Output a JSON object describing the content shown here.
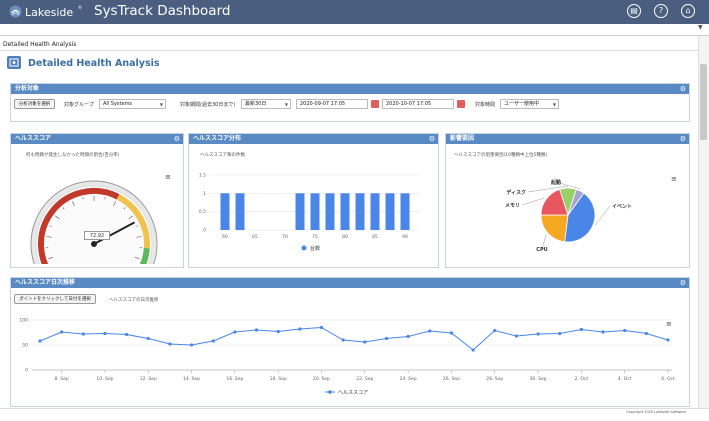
{
  "header": {
    "brand": "Lakeside",
    "brand_reg": "®",
    "app_title": "SysTrack Dashboard",
    "icons": [
      "clipboard-icon",
      "help-icon",
      "home-icon"
    ]
  },
  "breadcrumb": "Detailed Health Analysis",
  "page_title": "Detailed Health Analysis",
  "analysis": {
    "header": "分析対象",
    "select_button": "分析対象を選択",
    "group_label": "対象グループ",
    "group_value": "All Systems",
    "period_label": "対象期間(過去30日まで)",
    "period_value": "最新30日",
    "date_from": "2020-09-07 17:05",
    "date_to": "2020-10-07 17:05",
    "time_label": "対象時間",
    "time_value": "ユーザー使用中"
  },
  "health_score": {
    "header": "ヘルススコア",
    "subtitle": "何も問題が発生しなかった時間の割合(百分率)",
    "value_label": "72.92",
    "value": 72.92,
    "min": 0,
    "max": 100
  },
  "distribution": {
    "header": "ヘルススコア分布",
    "subtitle": "ヘルススコア毎の件数",
    "legend": "台数"
  },
  "impact": {
    "header": "影響要因",
    "subtitle": "ヘルススコアの阻害要因(10種類中上位5種類)"
  },
  "trend": {
    "header": "ヘルススコア日次推移",
    "button": "ポイントをクリックして日付を選択",
    "subtitle": "ヘルススコアの日次推移",
    "legend": "ヘルススコア"
  },
  "footer": {
    "copyright": "Copyright 2020 Lakeside Software"
  },
  "chart_data": [
    {
      "type": "bar",
      "title": "",
      "categories": [
        "60",
        "65",
        "70",
        "75",
        "80",
        "85",
        "90"
      ],
      "positions": [
        60,
        62.5,
        65,
        67.5,
        70,
        72.5,
        75,
        77.5,
        80,
        82.5,
        85,
        87.5,
        90
      ],
      "values": [
        1,
        1,
        0,
        0,
        0,
        1,
        1,
        1,
        1,
        1,
        1,
        1,
        1
      ],
      "series": [
        {
          "name": "台数",
          "values": [
            1,
            1,
            0,
            0,
            0,
            1,
            1,
            1,
            1,
            1,
            1,
            1,
            1
          ]
        }
      ],
      "y_ticks": [
        "0",
        "0.5",
        "1",
        "1.5"
      ],
      "ylim": [
        0,
        1.5
      ],
      "xlim": [
        57.5,
        92.5
      ],
      "grid": true,
      "legend_position": "bottom",
      "color": "#4a86e8"
    },
    {
      "type": "pie",
      "title": "",
      "labels": [
        "イベント",
        "CPU",
        "メモリ",
        "ディスク",
        "起動"
      ],
      "values": [
        42,
        23,
        20,
        10,
        5
      ],
      "colors": [
        "#4a86e8",
        "#f7a823",
        "#e8575f",
        "#9ad06a",
        "#a3a3d6"
      ]
    },
    {
      "type": "line",
      "title": "",
      "x_labels": [
        "8. Sep",
        "10. Sep",
        "12. Sep",
        "14. Sep",
        "16. Sep",
        "18. Sep",
        "20. Sep",
        "22. Sep",
        "24. Sep",
        "26. Sep",
        "28. Sep",
        "30. Sep",
        "2. Oct",
        "4. Oct",
        "6. Oct"
      ],
      "x": [
        "7. Sep",
        "8. Sep",
        "9. Sep",
        "10. Sep",
        "11. Sep",
        "12. Sep",
        "13. Sep",
        "14. Sep",
        "15. Sep",
        "16. Sep",
        "17. Sep",
        "18. Sep",
        "19. Sep",
        "20. Sep",
        "21. Sep",
        "22. Sep",
        "23. Sep",
        "24. Sep",
        "25. Sep",
        "26. Sep",
        "27. Sep",
        "28. Sep",
        "29. Sep",
        "30. Sep",
        "1. Oct",
        "2. Oct",
        "3. Oct",
        "4. Oct",
        "5. Oct",
        "6. Oct"
      ],
      "series": [
        {
          "name": "ヘルススコア",
          "values": [
            58,
            76,
            72,
            73,
            71,
            63,
            52,
            50,
            58,
            76,
            80,
            77,
            82,
            85,
            60,
            56,
            63,
            67,
            78,
            74,
            40,
            79,
            68,
            72,
            73,
            81,
            76,
            79,
            73,
            60
          ]
        }
      ],
      "y_ticks": [
        "0",
        "50",
        "100"
      ],
      "ylim": [
        0,
        100
      ],
      "grid": true,
      "legend_position": "bottom",
      "color": "#4a86e8"
    }
  ]
}
